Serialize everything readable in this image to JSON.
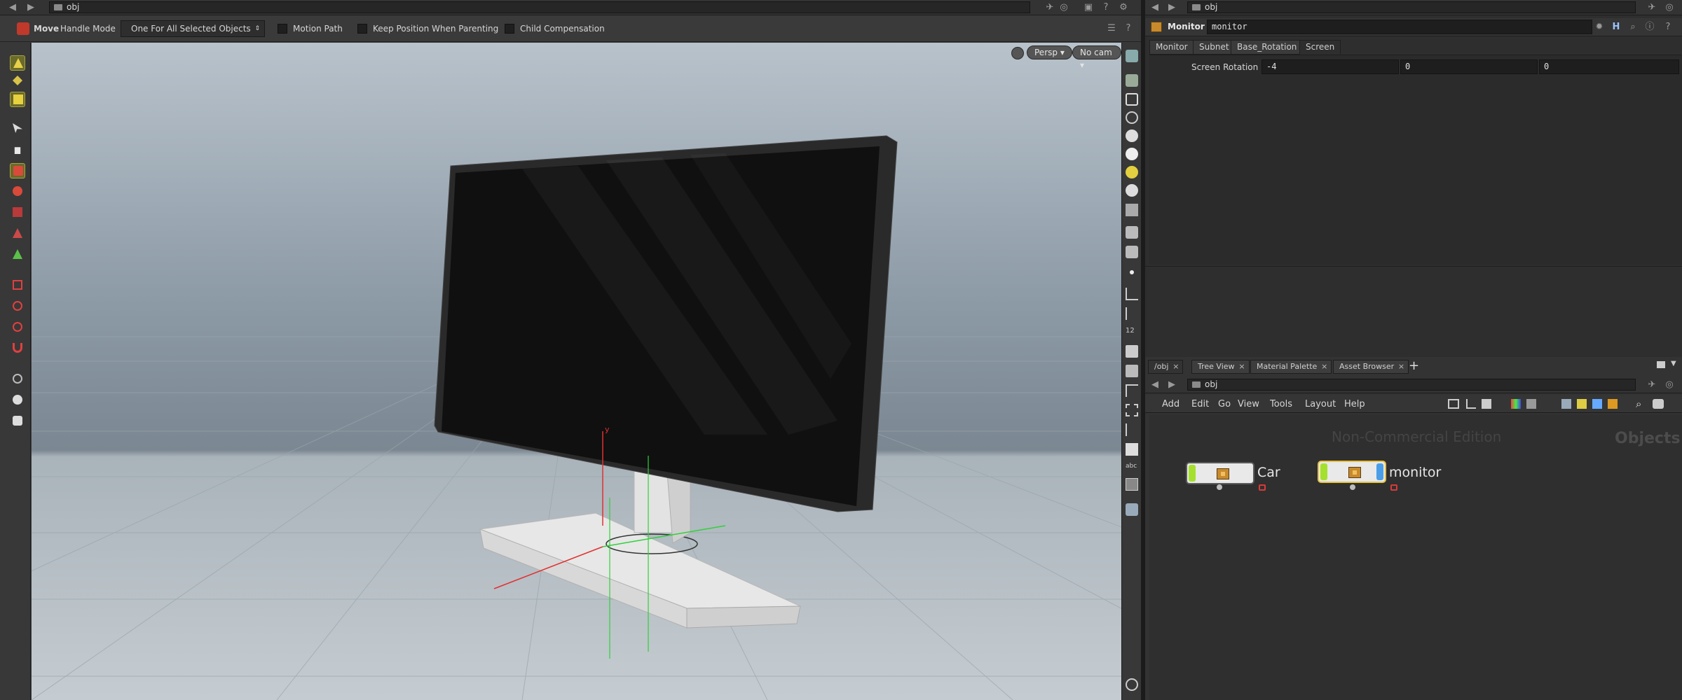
{
  "viewer": {
    "path": "obj",
    "tool_name": "Move",
    "handle_mode_label": "Handle Mode",
    "handle_mode_value": "One For All Selected Objects",
    "options": [
      "Motion Path",
      "Keep Position When Parenting",
      "Child Compensation"
    ],
    "camera": "Persp",
    "cam_select": "No cam",
    "axis_label_y": "y"
  },
  "parameters": {
    "path": "obj",
    "node_type": "Monitor",
    "node_name": "monitor",
    "tabs": [
      "Monitor",
      "Subnet",
      "Base_Rotation",
      "Screen"
    ],
    "active_tab": "Screen",
    "screen_rotation": {
      "label": "Screen Rotation",
      "values": [
        "-4",
        "0",
        "0"
      ]
    }
  },
  "network": {
    "tabs": [
      "/obj",
      "Tree View",
      "Material Palette",
      "Asset Browser"
    ],
    "add_tab": "+",
    "path": "obj",
    "menu": [
      "Add",
      "Edit",
      "Go",
      "View",
      "Tools",
      "Layout",
      "Help"
    ],
    "watermark": "Non-Commercial Edition",
    "context_label": "Objects",
    "nodes": [
      {
        "name": "Car"
      },
      {
        "name": "monitor"
      }
    ]
  },
  "icons": {
    "left_tools": [
      "select-icon",
      "pose-icon",
      "handle-icon",
      "move-icon",
      "scale-icon",
      "rotate-icon",
      "tumble-icon",
      "magnet-icon"
    ],
    "right_tools": [
      "display-icon",
      "lock-icon",
      "light-icon",
      "camera-icon",
      "info-icon"
    ]
  },
  "colors": {
    "node_flag_display": "#a5e02f",
    "node_flag_selected": "#4a9ee8",
    "axis_x": "#e23030",
    "axis_y": "#2fd03a",
    "lock": "#d83a3a"
  }
}
